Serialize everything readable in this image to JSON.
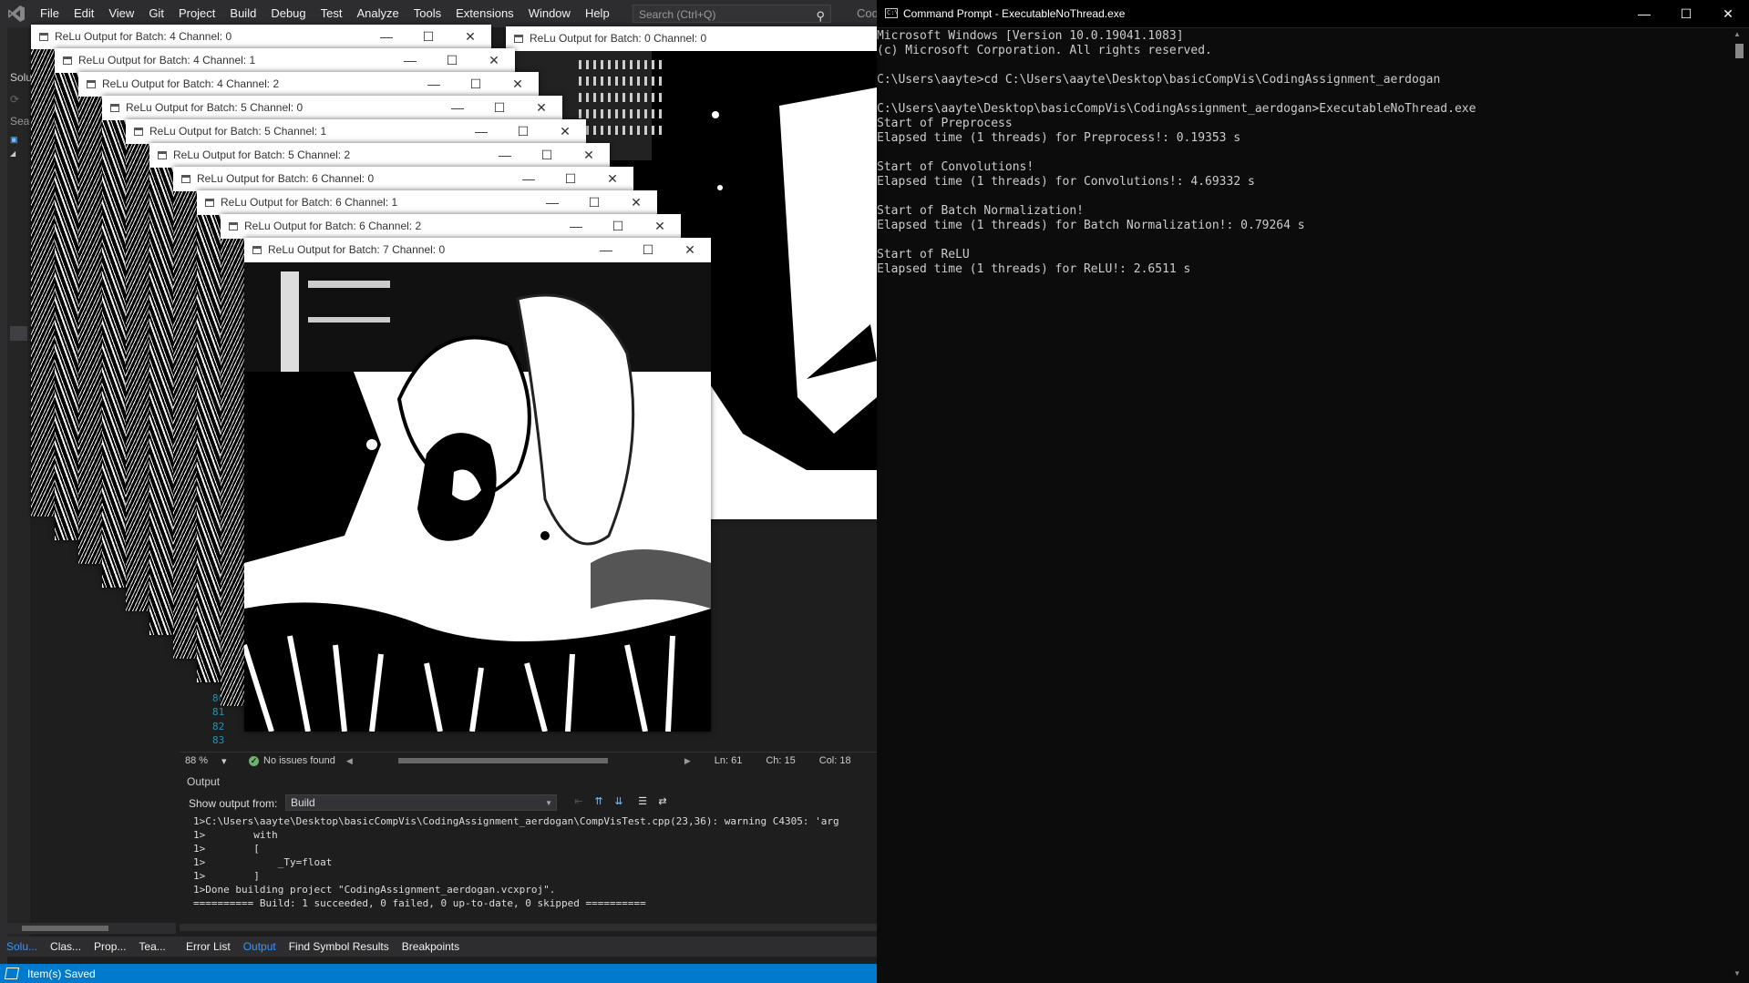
{
  "menubar": {
    "items": [
      "File",
      "Edit",
      "View",
      "Git",
      "Project",
      "Build",
      "Debug",
      "Test",
      "Analyze",
      "Tools",
      "Extensions",
      "Window",
      "Help"
    ],
    "search_placeholder": "Search (Ctrl+Q)",
    "truncated_label": "Cod"
  },
  "solution_panel": {
    "frag_top": "Solu",
    "frag_search": "Sea"
  },
  "editor": {
    "line_numbers": [
      "80",
      "81",
      "82",
      "83"
    ],
    "zoom": "88 %",
    "issues": "No issues found",
    "ln": "Ln: 61",
    "ch": "Ch: 15",
    "col": "Col: 18"
  },
  "output": {
    "title": "Output",
    "show_from_label": "Show output from:",
    "show_from_value": "Build",
    "lines": [
      "1>C:\\Users\\aayte\\Desktop\\basicCompVis\\CodingAssignment_aerdogan\\CompVisTest.cpp(23,36): warning C4305: 'arg",
      "1>        with",
      "1>        [",
      "1>            _Ty=float",
      "1>        ]",
      "1>Done building project \"CodingAssignment_aerdogan.vcxproj\".",
      "========== Build: 1 succeeded, 0 failed, 0 up-to-date, 0 skipped =========="
    ]
  },
  "bottom_tabs": {
    "left": [
      "Solu...",
      "Clas...",
      "Prop...",
      "Tea..."
    ],
    "right": [
      "Error List",
      "Output",
      "Find Symbol Results",
      "Breakpoints"
    ],
    "active": "Output"
  },
  "status_bar": {
    "text": "Item(s) Saved"
  },
  "image_windows": [
    {
      "title": "ReLu Output for Batch: 4 Channel: 0"
    },
    {
      "title": "ReLu Output for Batch: 4 Channel: 1"
    },
    {
      "title": "ReLu Output for Batch: 4 Channel: 2"
    },
    {
      "title": "ReLu Output for Batch: 5 Channel: 0"
    },
    {
      "title": "ReLu Output for Batch: 5 Channel: 1"
    },
    {
      "title": "ReLu Output for Batch: 5 Channel: 2"
    },
    {
      "title": "ReLu Output for Batch: 6 Channel: 0"
    },
    {
      "title": "ReLu Output for Batch: 6 Channel: 1"
    },
    {
      "title": "ReLu Output for Batch: 6 Channel: 2"
    },
    {
      "title": "ReLu Output for Batch: 7 Channel: 0"
    },
    {
      "title": "ReLu Output for Batch: 0 Channel: 0"
    }
  ],
  "window_controls": {
    "minimize": "—",
    "maximize": "☐",
    "close": "✕"
  },
  "cmd": {
    "title": "Command Prompt - ExecutableNoThread.exe",
    "icon_text": "C:\\",
    "lines": [
      "Microsoft Windows [Version 10.0.19041.1083]",
      "(c) Microsoft Corporation. All rights reserved.",
      "",
      "C:\\Users\\aayte>cd C:\\Users\\aayte\\Desktop\\basicCompVis\\CodingAssignment_aerdogan",
      "",
      "C:\\Users\\aayte\\Desktop\\basicCompVis\\CodingAssignment_aerdogan>ExecutableNoThread.exe",
      "Start of Preprocess",
      "Elapsed time (1 threads) for Preprocess!: 0.19353 s",
      "",
      "Start of Convolutions!",
      "Elapsed time (1 threads) for Convolutions!: 4.69332 s",
      "",
      "Start of Batch Normalization!",
      "Elapsed time (1 threads) for Batch Normalization!: 0.79264 s",
      "",
      "Start of ReLU",
      "Elapsed time (1 threads) for ReLU!: 2.6511 s"
    ]
  },
  "icons": {
    "vs_logo": "visual-studio-logo-icon",
    "search": "search-icon",
    "ok": "check-circle-icon",
    "save": "item-saved-icon"
  },
  "colors": {
    "status_bar": "#007acc",
    "active_tab": "#3794ff",
    "editor_bg": "#1e1e1e",
    "cmd_bg": "#0c0c0c"
  }
}
